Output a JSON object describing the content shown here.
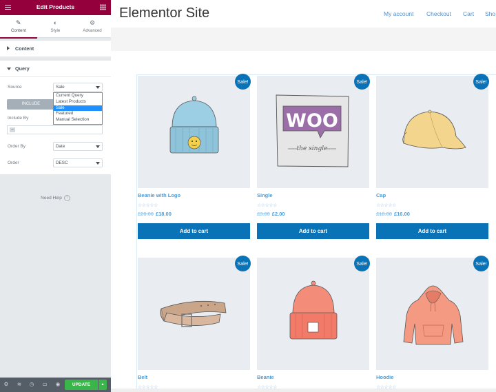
{
  "panel": {
    "title": "Edit Products",
    "tabs": [
      {
        "label": "Content",
        "icon": "pencil-icon"
      },
      {
        "label": "Style",
        "icon": "half-circle-icon"
      },
      {
        "label": "Advanced",
        "icon": "gear-icon"
      }
    ],
    "sections": {
      "content": "Content",
      "query": "Query"
    },
    "query": {
      "source_label": "Source",
      "source_value": "Sale",
      "include_label": "INCLUDE",
      "include_by_label": "Include By",
      "include_tag": "–",
      "order_by_label": "Order By",
      "order_by_value": "Date",
      "order_label": "Order",
      "order_value": "DESC"
    },
    "source_options": [
      "Current Query",
      "Latest Products",
      "Sale",
      "Featured",
      "Manual Selection"
    ],
    "help": "Need Help",
    "footer": {
      "update": "UPDATE"
    }
  },
  "site": {
    "title": "Elementor Site",
    "nav": [
      "My account",
      "Checkout",
      "Cart",
      "Sho"
    ]
  },
  "products": [
    {
      "name": "Beanie with Logo",
      "old": "£20.00",
      "new": "£18.00",
      "badge": "Sale!",
      "button": "Add to cart",
      "stars": "☆☆☆☆☆"
    },
    {
      "name": "Single",
      "old": "£3.00",
      "new": "£2.00",
      "badge": "Sale!",
      "button": "Add to cart",
      "stars": "☆☆☆☆☆"
    },
    {
      "name": "Cap",
      "old": "£18.00",
      "new": "£16.00",
      "badge": "Sale!",
      "button": "Add to cart",
      "stars": "☆☆☆☆☆"
    },
    {
      "name": "Belt",
      "badge": "Sale!",
      "stars": "☆☆☆☆☆"
    },
    {
      "name": "Beanie",
      "badge": "Sale!",
      "stars": "☆☆☆☆☆"
    },
    {
      "name": "Hoodie",
      "badge": "Sale!",
      "stars": "☆☆☆☆☆"
    }
  ],
  "woo_logo": {
    "text": "WOO",
    "sub": "the single"
  },
  "colors": {
    "brand": "#93003c",
    "accent": "#0a73b7",
    "update": "#39b54a"
  }
}
